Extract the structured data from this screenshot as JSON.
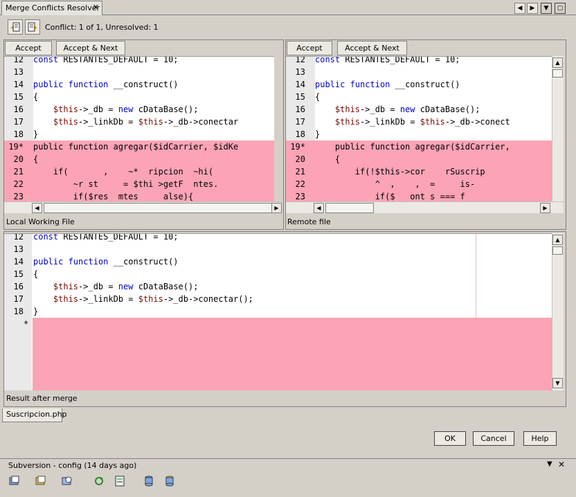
{
  "window": {
    "tab_title": "Merge Conflicts Resolver",
    "status": "Conflict: 1 of 1, Unresolved: 1"
  },
  "left_panel": {
    "accept_label": "Accept",
    "accept_next_label": "Accept & Next",
    "caption": "Local Working File",
    "lines": [
      {
        "n": "12",
        "t": "const RESTANTES_DEFAULT = 10;",
        "c": false
      },
      {
        "n": "13",
        "t": "",
        "c": false
      },
      {
        "n": "14",
        "t": "public function __construct()",
        "c": false
      },
      {
        "n": "15",
        "t": "{",
        "c": false
      },
      {
        "n": "16",
        "t": "    $this->_db = new cDataBase();",
        "c": false
      },
      {
        "n": "17",
        "t": "    $this->_linkDb = $this->_db->conectar",
        "c": false
      },
      {
        "n": "18",
        "t": "}",
        "c": false
      },
      {
        "n": "19*",
        "t": "public function agregar($idCarrier, $idKe",
        "c": true
      },
      {
        "n": "20",
        "t": "{",
        "c": true
      },
      {
        "n": "21",
        "t": "    if(       ,    ~*  ripcion  ~hi(",
        "c": true
      },
      {
        "n": "22",
        "t": "        ~r st     = $thi >getF  ntes.",
        "c": true
      },
      {
        "n": "23",
        "t": "        if($res  mtes     alse){",
        "c": true
      }
    ]
  },
  "right_panel": {
    "accept_label": "Accept",
    "accept_next_label": "Accept & Next",
    "caption": "Remote file",
    "lines": [
      {
        "n": "12",
        "t": "const RESTANTES_DEFAULT = 10;",
        "c": false
      },
      {
        "n": "13",
        "t": "",
        "c": false
      },
      {
        "n": "14",
        "t": "public function __construct()",
        "c": false
      },
      {
        "n": "15",
        "t": "{",
        "c": false
      },
      {
        "n": "16",
        "t": "    $this->_db = new cDataBase();",
        "c": false
      },
      {
        "n": "17",
        "t": "    $this->_linkDb = $this->_db->conect",
        "c": false
      },
      {
        "n": "18",
        "t": "}",
        "c": false
      },
      {
        "n": "19*",
        "t": "    public function agregar($idCarrier,",
        "c": true
      },
      {
        "n": "20",
        "t": "    {",
        "c": true
      },
      {
        "n": "21",
        "t": "        if(!$this->cor    rSuscrip",
        "c": true
      },
      {
        "n": "22",
        "t": "            ^  ,    ,  =     is-",
        "c": true
      },
      {
        "n": "23",
        "t": "            if($   ont s === f",
        "c": true
      }
    ]
  },
  "result_panel": {
    "caption": "Result after merge",
    "lines": [
      {
        "n": "12",
        "t": "const RESTANTES_DEFAULT = 10;"
      },
      {
        "n": "13",
        "t": ""
      },
      {
        "n": "14",
        "t": "public function __construct()"
      },
      {
        "n": "15",
        "t": "{"
      },
      {
        "n": "16",
        "t": "    $this->_db = new cDataBase();"
      },
      {
        "n": "17",
        "t": "    $this->_linkDb = $this->_db->conectar();"
      },
      {
        "n": "18",
        "t": "}"
      }
    ],
    "conflict_marker": "*"
  },
  "file_tab": "Suscripcion.php",
  "dialog": {
    "ok_label": "OK",
    "cancel_label": "Cancel",
    "help_label": "Help"
  },
  "subversion_bar": {
    "title": "Subversion - config (14 days ago)"
  },
  "colors": {
    "conflict": "#fca4b5",
    "keyword": "#0000c8",
    "variable": "#7a0a00",
    "chrome": "#d4d0c8"
  }
}
